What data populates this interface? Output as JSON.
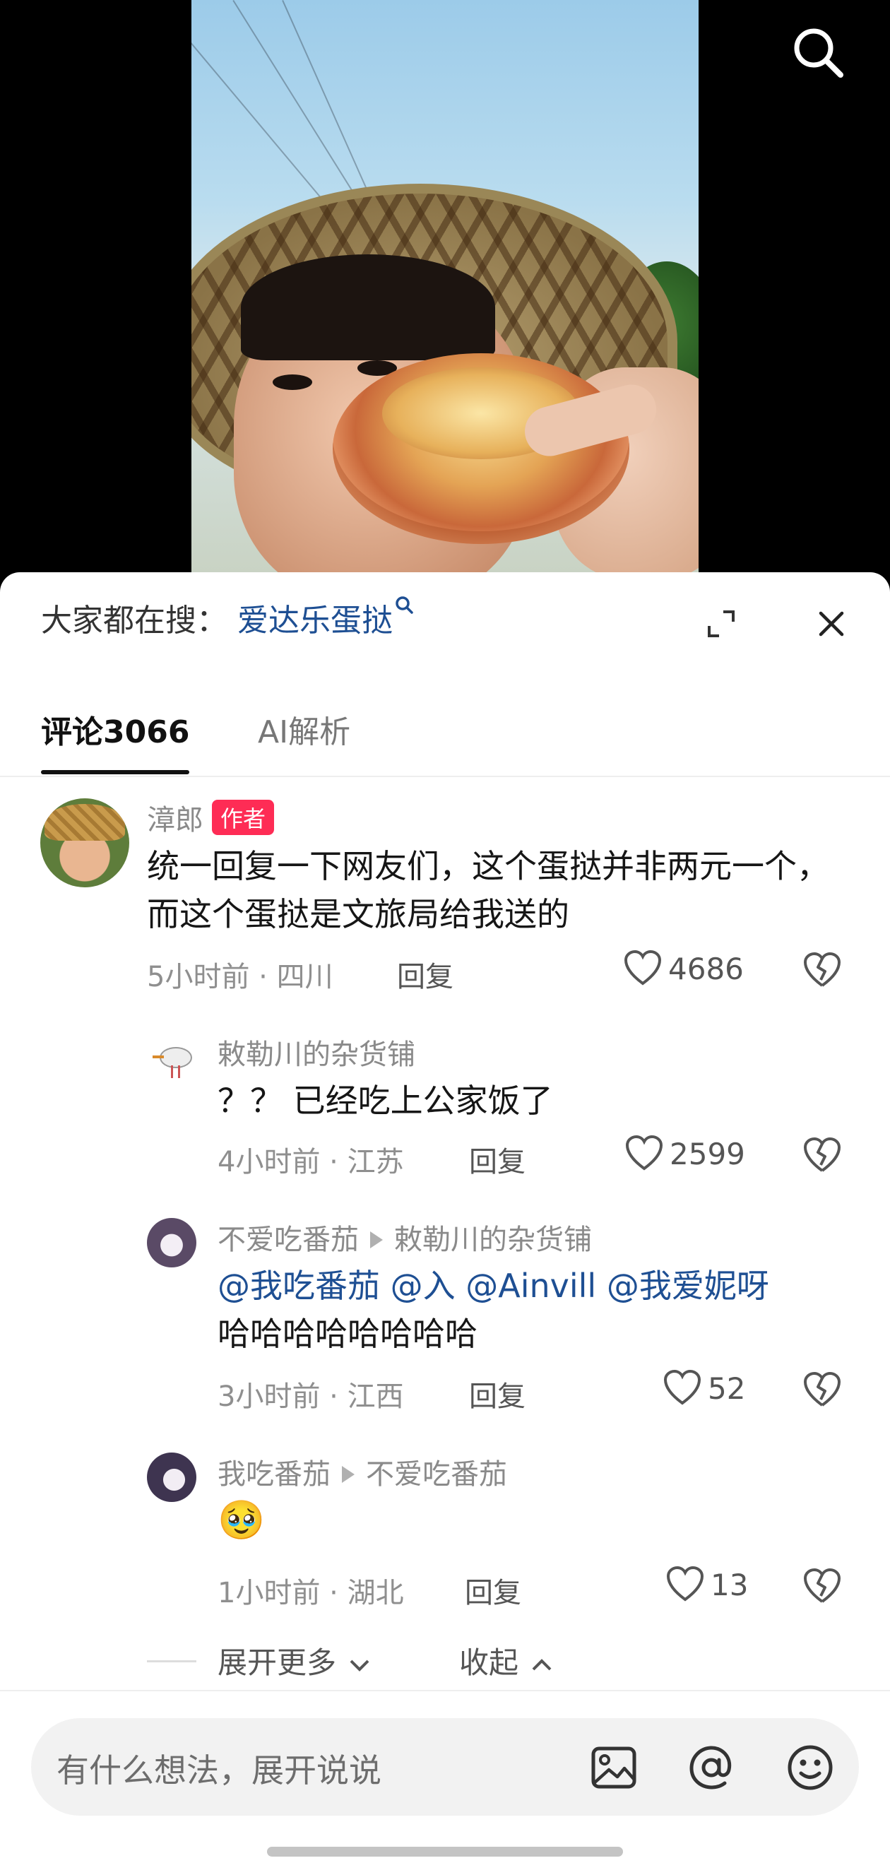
{
  "top_icons": {
    "search": "search-icon"
  },
  "hot_search": {
    "label": "大家都在搜：",
    "keyword": "爱达乐蛋挞"
  },
  "tabs": [
    {
      "label": "评论3066"
    },
    {
      "label": "AI解析"
    }
  ],
  "comments": [
    {
      "username": "漳郎",
      "badge": "作者",
      "text": "统一回复一下网友们，这个蛋挞并非两元一个，而这个蛋挞是文旅局给我送的",
      "meta": "5小时前 · 四川",
      "reply_label": "回复",
      "likes": "4686"
    },
    {
      "username": "敕勒川的杂货铺",
      "text": "？？ 已经吃上公家饭了",
      "meta": "4小时前 · 江苏",
      "reply_label": "回复",
      "likes": "2599"
    },
    {
      "username": "不爱吃番茄",
      "reply_to": "敕勒川的杂货铺",
      "mentions": "@我吃番茄 @入 @Ainvill @我爱妮呀",
      "text": "哈哈哈哈哈哈哈哈",
      "meta": "3小时前 · 江西",
      "reply_label": "回复",
      "likes": "52"
    },
    {
      "username": "我吃番茄",
      "reply_to": "不爱吃番茄",
      "text": "🥹",
      "meta": "1小时前 · 湖北",
      "reply_label": "回复",
      "likes": "13"
    }
  ],
  "thread_controls": {
    "expand_more": "展开更多",
    "collapse": "收起"
  },
  "input": {
    "placeholder": "有什么想法，展开说说"
  },
  "colors": {
    "accent_link": "#1e4f93",
    "author_badge": "#fe2c55"
  }
}
